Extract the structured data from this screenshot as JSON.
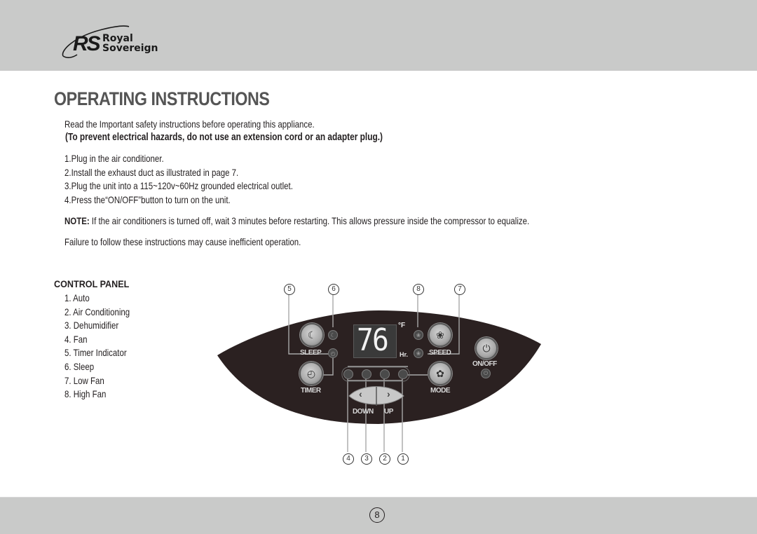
{
  "brand": {
    "monogram": "RS",
    "name_line1": "Royal",
    "name_line2": "Sovereign"
  },
  "page_title": "OPERATING INSTRUCTIONS",
  "intro": {
    "line1": "Read the Important safety instructions before operating this appliance.",
    "warning": "(To prevent electrical hazards, do not use an extension cord or an adapter plug.)"
  },
  "steps": [
    "1.Plug in the air conditioner.",
    "2.Install the exhaust duct as illustrated in page 7.",
    "3.Plug the unit into a 115~120v~60Hz grounded electrical outlet.",
    "4.Press the“ON/OFF”button to turn on the unit."
  ],
  "note": {
    "label": "NOTE:",
    "text": " If the air conditioners is turned off, wait 3 minutes before restarting. This allows pressure inside the compressor to equalize."
  },
  "failure_text": "Failure to follow these instructions may cause inefficient operation.",
  "control_panel": {
    "title": "CONTROL PANEL",
    "items": [
      "1. Auto",
      "2. Air Conditioning",
      "3. Dehumidifier",
      "4. Fan",
      "5. Timer Indicator",
      "6. Sleep",
      "7. Low Fan",
      "8. High Fan"
    ],
    "callouts_top": [
      "⑤",
      "⑥",
      "⑧",
      "⑦"
    ],
    "callouts_bottom": [
      "④",
      "③",
      "②",
      "①"
    ],
    "display_value": "76",
    "unit_temp": "°F",
    "unit_time": "Hr.",
    "labels": {
      "sleep": "SLEEP",
      "timer": "TIMER",
      "speed": "SPEED",
      "mode": "MODE",
      "on_off": "ON/OFF",
      "down": "DOWN",
      "up": "UP"
    },
    "icons": {
      "sleep": "☾",
      "timer": "◴",
      "speed": "❀",
      "mode": "✿",
      "power": "⏻",
      "down": "‹",
      "up": "›"
    }
  },
  "page_number": "8",
  "colors": {
    "band_gray": "#c9cac9",
    "panel_dark": "#2b2121",
    "title_gray": "#555555"
  }
}
